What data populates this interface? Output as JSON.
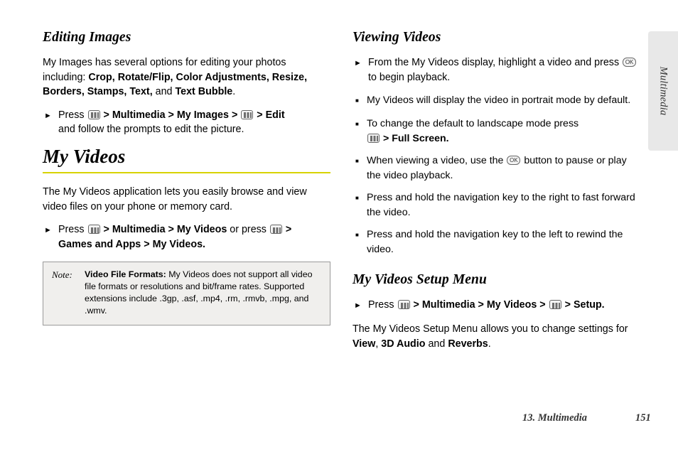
{
  "side_tab": {
    "label": "Multimedia"
  },
  "left": {
    "heading": "Editing Images",
    "intro_pre": "My Images has several options for editing your photos including: ",
    "intro_bold1": "Crop, Rotate/Flip, Color Adjustments, Resize, Borders, Stamps, Text,",
    "intro_mid": " and ",
    "intro_bold2": "Text Bubble",
    "intro_end": ".",
    "bullet1": {
      "press": "Press",
      "gt1": ">",
      "multimedia": "Multimedia",
      "gt2": ">",
      "my_images": "My Images",
      "gt3": ">",
      "gt4": ">",
      "edit": "Edit",
      "tail": "and follow the prompts to edit the picture."
    },
    "big_heading": "My Videos",
    "para": "The My Videos application lets you easily browse and view video files on your phone or memory card.",
    "bullet2": {
      "press": "Press",
      "gt1": ">",
      "multimedia": "Multimedia",
      "gt2": ">",
      "my_videos": "My Videos",
      "orpress": "or press",
      "gt3": ">",
      "games_apps": "Games and Apps",
      "gt4": ">",
      "my_videos2": "My Videos."
    },
    "note": {
      "label": "Note:",
      "bold": "Video File Formats:",
      "text": " My Videos does not support all video file formats or resolutions and bit/frame rates. Supported extensions include .3gp, .asf, .mp4, .rm, .rmvb, .mpg, and .wmv."
    }
  },
  "right": {
    "heading": "Viewing Videos",
    "bullet1": {
      "pre": "From the My Videos display, highlight a video and press",
      "post": "to begin playback."
    },
    "subs": [
      {
        "text": "My Videos will display the video in portrait mode by default."
      },
      {
        "pre": "To change the default to landscape mode press",
        "bold": "Full Screen.",
        "gt": ">"
      },
      {
        "pre": "When viewing a video, use the",
        "post": "button to pause or play the video playback."
      },
      {
        "text": "Press and hold the navigation key to the right to fast forward the video."
      },
      {
        "text": "Press and hold the navigation key to the left to rewind the video."
      }
    ],
    "heading2": "My Videos Setup Menu",
    "bullet2": {
      "press": "Press",
      "gt1": ">",
      "multimedia": "Multimedia",
      "gt2": ">",
      "my_videos": "My Videos",
      "gt3": ">",
      "gt4": ">",
      "setup": "Setup."
    },
    "para_pre": "The My Videos Setup Menu allows you to change settings for ",
    "para_b1": "View",
    "para_c1": ", ",
    "para_b2": "3D Audio",
    "para_mid": " and ",
    "para_b3": "Reverbs",
    "para_end": "."
  },
  "footer": {
    "chapter": "13. Multimedia",
    "page": "151"
  }
}
